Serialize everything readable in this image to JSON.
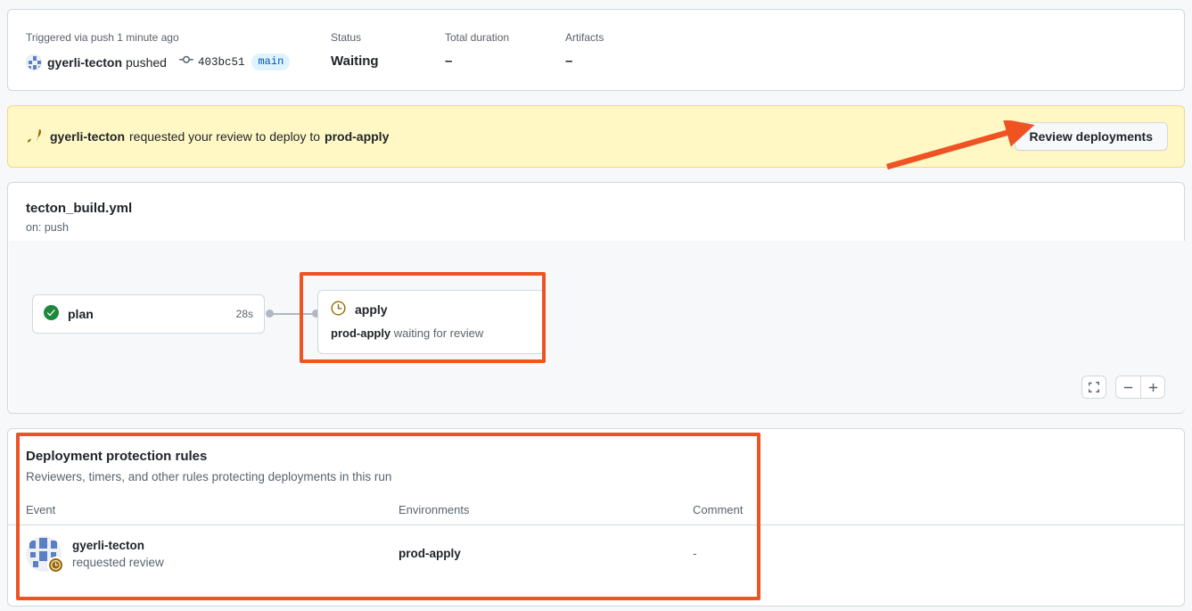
{
  "summary": {
    "trigger": {
      "label": "Triggered via push 1 minute ago",
      "actor": "gyerli-tecton",
      "action": "pushed",
      "commit_sha": "403bc51",
      "branch": "main",
      "commit_icon": "git-commit-icon",
      "avatar_icon": "user-avatar-identicon"
    },
    "status": {
      "label": "Status",
      "value": "Waiting"
    },
    "duration": {
      "label": "Total duration",
      "value": "–"
    },
    "artifacts": {
      "label": "Artifacts",
      "value": "–"
    }
  },
  "review_banner": {
    "icon": "rocket-icon",
    "actor": "gyerli-tecton",
    "message": "requested your review to deploy to",
    "environment": "prod-apply",
    "button_label": "Review deployments"
  },
  "workflow": {
    "title": "tecton_build.yml",
    "subtitle": "on: push",
    "nodes": [
      {
        "id": "plan",
        "label": "plan",
        "duration": "28s",
        "status_icon": "check-circle-fill-icon",
        "status_color": "#1f883d"
      },
      {
        "id": "apply",
        "label": "apply",
        "status_icon": "clock-icon",
        "status_color": "#9a6700",
        "detail_environment": "prod-apply",
        "detail_text": "waiting for review"
      }
    ],
    "controls": {
      "fullscreen_icon": "fullscreen-icon",
      "zoom_out_icon": "minus-icon",
      "zoom_in_icon": "plus-icon"
    }
  },
  "protection_rules": {
    "title": "Deployment protection rules",
    "subtitle": "Reviewers, timers, and other rules protecting deployments in this run",
    "columns": {
      "event": "Event",
      "environments": "Environments",
      "comment": "Comment"
    },
    "rows": [
      {
        "actor": "gyerli-tecton",
        "action": "requested review",
        "avatar_icon": "user-avatar-identicon",
        "badge_icon": "clock-badge-icon",
        "environment": "prod-apply",
        "comment": "-"
      }
    ]
  },
  "annotations": {
    "accent_color": "#ef5223",
    "boxes": [
      "apply-node-highlight",
      "deployment-protection-rules-highlight"
    ],
    "arrow": "arrow-to-review-deployments-button"
  }
}
